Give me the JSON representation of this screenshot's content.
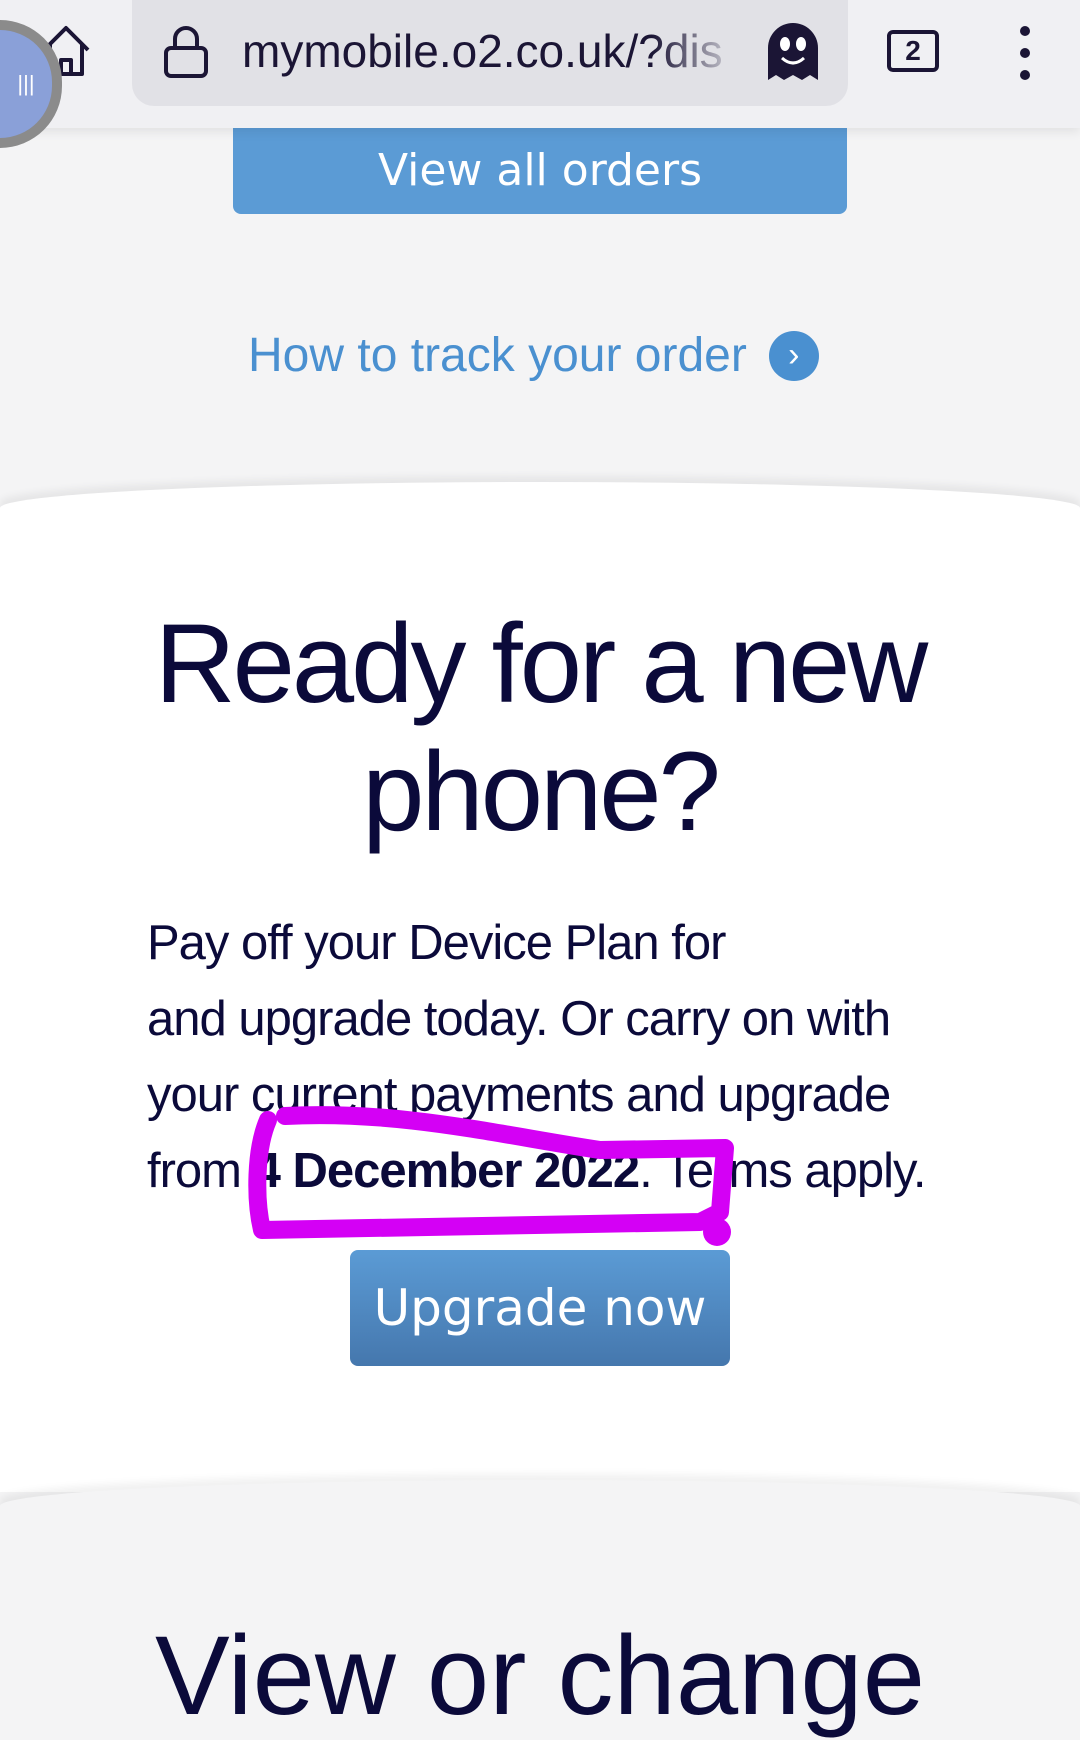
{
  "browser": {
    "url": "mymobile.o2.co.uk/?dis",
    "tab_count": "2",
    "icons": [
      "home-icon",
      "lock-icon",
      "ghost-icon",
      "tabs-icon",
      "more-vert-icon",
      "voice-assistant-icon"
    ]
  },
  "orders": {
    "view_all_label": "View all orders",
    "track_link": "How to track your order"
  },
  "upgrade": {
    "heading": "Ready for a new phone?",
    "para_1": "Pay off your Device Plan for",
    "para_2": "and upgrade today. Or carry on with your current payments and upgrade from ",
    "date": "4 December 2022",
    "para_3": ". Terms apply.",
    "button_label": "Upgrade now"
  },
  "next_section": {
    "heading": "View or change"
  },
  "colors": {
    "accent": "#5b9bd5",
    "text": "#0b0a3a",
    "annotation": "#d400f5"
  }
}
